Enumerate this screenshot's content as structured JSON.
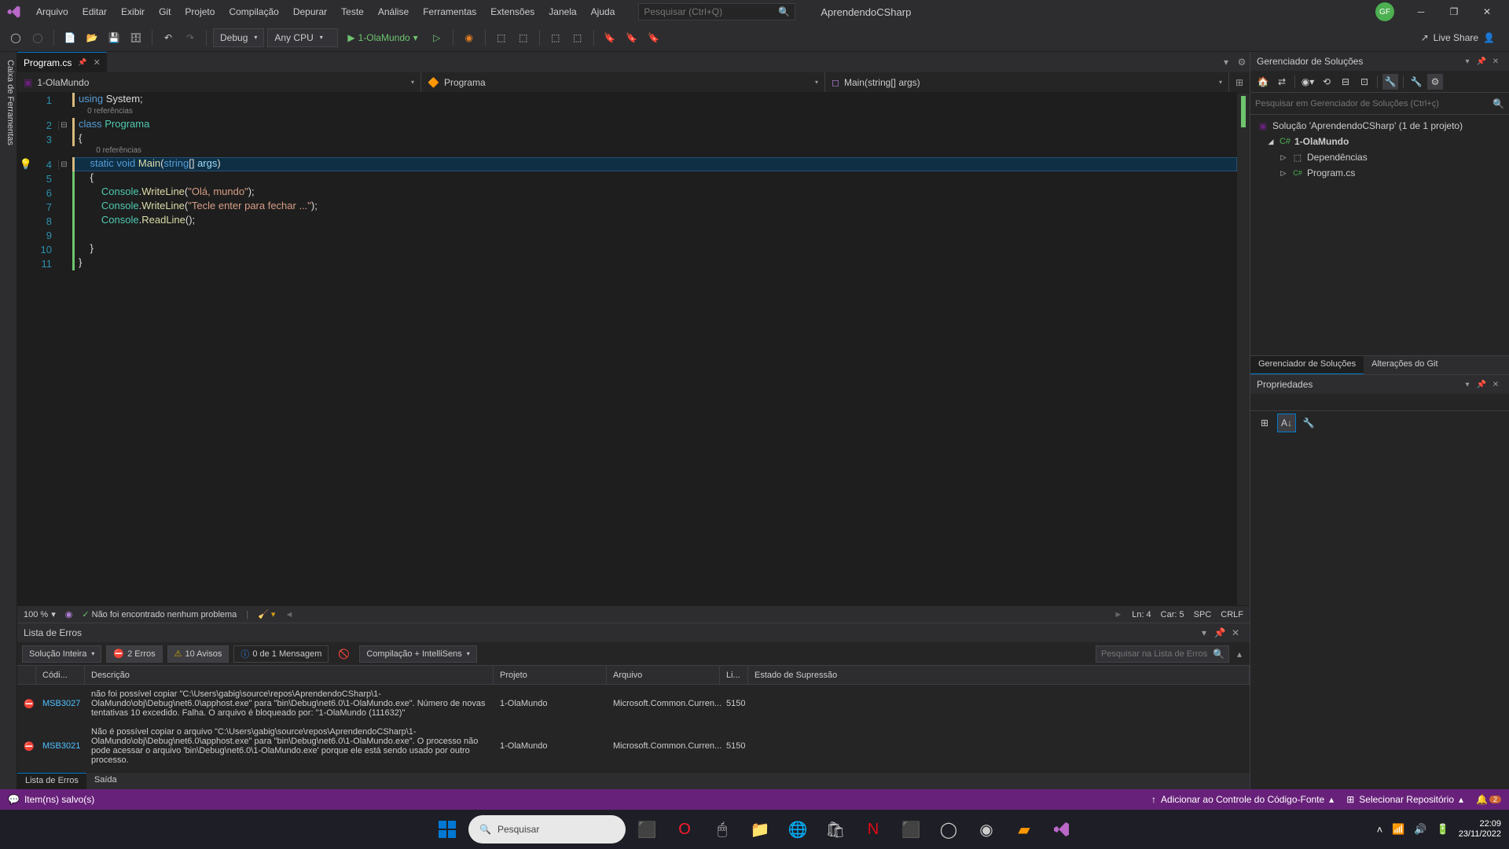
{
  "menubar": {
    "items": [
      "Arquivo",
      "Editar",
      "Exibir",
      "Git",
      "Projeto",
      "Compilação",
      "Depurar",
      "Teste",
      "Análise",
      "Ferramentas",
      "Extensões",
      "Janela",
      "Ajuda"
    ],
    "search_placeholder": "Pesquisar (Ctrl+Q)",
    "project_name": "AprendendoCSharp",
    "avatar_initials": "GF"
  },
  "toolbar": {
    "config": "Debug",
    "platform": "Any CPU",
    "start_target": "1-OlaMundo",
    "live_share": "Live Share"
  },
  "sidebar_toolbox": "Caixa de Ferramentas",
  "tabs": {
    "file": "Program.cs"
  },
  "nav": {
    "project": "1-OlaMundo",
    "class": "Programa",
    "member": "Main(string[] args)"
  },
  "code": {
    "ref_text": "0 referências",
    "lines": [
      {
        "n": 1,
        "ind": "yellow",
        "tokens": [
          {
            "t": "using ",
            "c": "kw"
          },
          {
            "t": "System",
            "c": "pln"
          },
          {
            "t": ";",
            "c": "pln"
          }
        ]
      },
      {
        "ref": true,
        "text": "0 referências",
        "indent": "    "
      },
      {
        "n": 2,
        "ind": "yellow",
        "fold": "⊟",
        "tokens": [
          {
            "t": "class ",
            "c": "kw"
          },
          {
            "t": "Programa",
            "c": "cls"
          }
        ]
      },
      {
        "n": 3,
        "ind": "yellow",
        "tokens": [
          {
            "t": "{",
            "c": "pln"
          }
        ]
      },
      {
        "ref": true,
        "text": "0 referências",
        "indent": "        "
      },
      {
        "n": 4,
        "ind": "yellow",
        "fold": "⊟",
        "hl": true,
        "bulb": true,
        "tokens": [
          {
            "t": "    ",
            "c": "pln"
          },
          {
            "t": "static ",
            "c": "kw"
          },
          {
            "t": "void ",
            "c": "kw"
          },
          {
            "t": "Main",
            "c": "method"
          },
          {
            "t": "(",
            "c": "pln"
          },
          {
            "t": "string",
            "c": "kw"
          },
          {
            "t": "[] ",
            "c": "pln"
          },
          {
            "t": "args",
            "c": "param"
          },
          {
            "t": ")",
            "c": "pln"
          }
        ]
      },
      {
        "n": 5,
        "ind": "green",
        "tokens": [
          {
            "t": "    {",
            "c": "pln"
          }
        ]
      },
      {
        "n": 6,
        "ind": "green",
        "tokens": [
          {
            "t": "        ",
            "c": "pln"
          },
          {
            "t": "Console",
            "c": "cls"
          },
          {
            "t": ".",
            "c": "pln"
          },
          {
            "t": "WriteLine",
            "c": "method"
          },
          {
            "t": "(",
            "c": "pln"
          },
          {
            "t": "\"Olá, mundo\"",
            "c": "str"
          },
          {
            "t": ");",
            "c": "pln"
          }
        ]
      },
      {
        "n": 7,
        "ind": "green",
        "tokens": [
          {
            "t": "        ",
            "c": "pln"
          },
          {
            "t": "Console",
            "c": "cls"
          },
          {
            "t": ".",
            "c": "pln"
          },
          {
            "t": "WriteLine",
            "c": "method"
          },
          {
            "t": "(",
            "c": "pln"
          },
          {
            "t": "\"Tecle enter para fechar ...\"",
            "c": "str"
          },
          {
            "t": ");",
            "c": "pln"
          }
        ]
      },
      {
        "n": 8,
        "ind": "green",
        "tokens": [
          {
            "t": "        ",
            "c": "pln"
          },
          {
            "t": "Console",
            "c": "cls"
          },
          {
            "t": ".",
            "c": "pln"
          },
          {
            "t": "ReadLine",
            "c": "method"
          },
          {
            "t": "();",
            "c": "pln"
          }
        ]
      },
      {
        "n": 9,
        "ind": "green",
        "tokens": [
          {
            "t": " ",
            "c": "pln"
          }
        ]
      },
      {
        "n": 10,
        "ind": "green",
        "tokens": [
          {
            "t": "    }",
            "c": "pln"
          }
        ]
      },
      {
        "n": 11,
        "ind": "green",
        "tokens": [
          {
            "t": "}",
            "c": "pln"
          }
        ]
      }
    ]
  },
  "editor_status": {
    "zoom": "100 %",
    "issues": "Não foi encontrado nenhum problema",
    "ln": "Ln: 4",
    "car": "Car: 5",
    "spc": "SPC",
    "crlf": "CRLF"
  },
  "error_panel": {
    "title": "Lista de Erros",
    "scope": "Solução Inteira",
    "errors_label": "2 Erros",
    "warnings_label": "10 Avisos",
    "messages_label": "0 de 1 Mensagem",
    "build_filter": "Compilação + IntelliSens",
    "search_placeholder": "Pesquisar na Lista de Erros",
    "cols": {
      "code": "Códi...",
      "desc": "Descrição",
      "proj": "Projeto",
      "file": "Arquivo",
      "line": "Li...",
      "supp": "Estado de Supressão"
    },
    "rows": [
      {
        "code": "MSB3027",
        "desc": "não foi possível copiar \"C:\\Users\\gabig\\source\\repos\\AprendendoCSharp\\1-OlaMundo\\obj\\Debug\\net6.0\\apphost.exe\" para \"bin\\Debug\\net6.0\\1-OlaMundo.exe\". Número de novas tentativas 10 excedido. Falha. O arquivo é bloqueado por: \"1-OlaMundo (111632)\"",
        "proj": "1-OlaMundo",
        "file": "Microsoft.Common.Curren...",
        "line": "5150"
      },
      {
        "code": "MSB3021",
        "desc": "Não é possível copiar o arquivo \"C:\\Users\\gabig\\source\\repos\\AprendendoCSharp\\1-OlaMundo\\obj\\Debug\\net6.0\\apphost.exe\" para \"bin\\Debug\\net6.0\\1-OlaMundo.exe\". O processo não pode acessar o arquivo 'bin\\Debug\\net6.0\\1-OlaMundo.exe' porque ele está sendo usado por outro processo.",
        "proj": "1-OlaMundo",
        "file": "Microsoft.Common.Curren...",
        "line": "5150"
      }
    ]
  },
  "bottom_tabs": {
    "errors": "Lista de Erros",
    "output": "Saída"
  },
  "solution": {
    "title": "Gerenciador de Soluções",
    "search_placeholder": "Pesquisar em Gerenciador de Soluções (Ctrl+ç)",
    "root": "Solução 'AprendendoCSharp' (1 de 1 projeto)",
    "project": "1-OlaMundo",
    "deps": "Dependências",
    "file": "Program.cs",
    "tabs": {
      "sln": "Gerenciador de Soluções",
      "git": "Alterações do Git"
    }
  },
  "props": {
    "title": "Propriedades"
  },
  "statusbar": {
    "left": "Item(ns) salvo(s)",
    "add_source": "Adicionar ao Controle do Código-Fonte",
    "select_repo": "Selecionar Repositório",
    "notifications": "2"
  },
  "taskbar": {
    "search": "Pesquisar",
    "time": "22:09",
    "date": "23/11/2022"
  }
}
